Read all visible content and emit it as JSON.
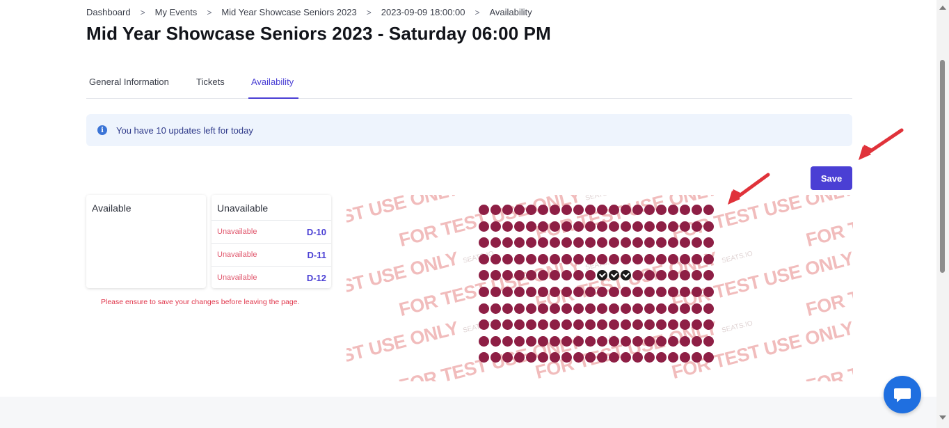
{
  "breadcrumb": {
    "items": [
      "Dashboard",
      "My Events",
      "Mid Year Showcase Seniors 2023",
      "2023-09-09 18:00:00",
      "Availability"
    ],
    "separator": ">"
  },
  "page": {
    "title": "Mid Year Showcase Seniors 2023 - Saturday 06:00 PM"
  },
  "tabs": [
    {
      "label": "General Information",
      "active": false
    },
    {
      "label": "Tickets",
      "active": false
    },
    {
      "label": "Availability",
      "active": true
    }
  ],
  "alert": {
    "icon": "info-icon",
    "text": "You have 10 updates left for today"
  },
  "save_button": {
    "label": "Save"
  },
  "available_card": {
    "title": "Available",
    "seats": []
  },
  "unavailable_card": {
    "title": "Unavailable",
    "rows": [
      {
        "status": "Unavailable",
        "seat": "D-10"
      },
      {
        "status": "Unavailable",
        "seat": "D-11"
      },
      {
        "status": "Unavailable",
        "seat": "D-12"
      }
    ]
  },
  "notice": "Please ensure to save your changes before leaving the page.",
  "seat_map": {
    "rows": 10,
    "seats_per_row": 20,
    "selected_row": 4,
    "selected_seats": [
      10,
      11,
      12
    ],
    "seat_color": "#8e1f45",
    "selected_color": "#1a1a1a",
    "watermark_main": "FOR TEST USE ONLY",
    "watermark_brand": "SEATS.IO"
  },
  "colors": {
    "accent": "#4a3fd4",
    "alert_bg": "#eef4fd",
    "error": "#e0354a"
  },
  "chat": {
    "icon": "chat-bubble-icon"
  }
}
